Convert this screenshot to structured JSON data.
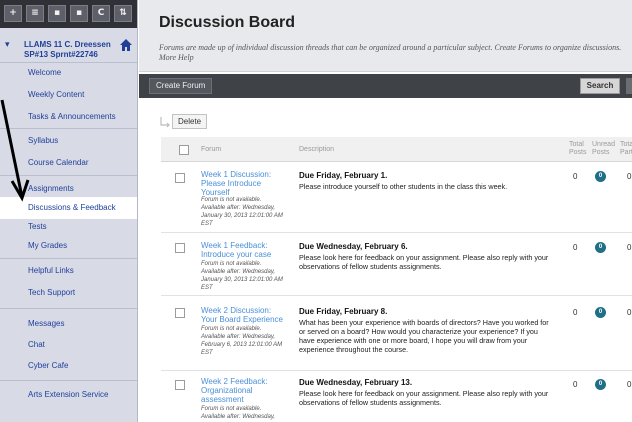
{
  "colors": {
    "sidebar_bg": "#d8dbe6",
    "toolbar_bg": "#2f3136",
    "link_blue": "#1f3f99",
    "forum_link": "#4a8fd8",
    "action_bar": "#3f4247",
    "badge": "#1f6f87"
  },
  "toolbar": {
    "buttons": [
      {
        "label": "+",
        "icon": "plus-icon"
      },
      {
        "label": "≡",
        "icon": "list-icon"
      },
      {
        "label": "▪",
        "icon": "folder-icon"
      },
      {
        "label": "▪",
        "icon": "window-icon"
      },
      {
        "label": "C",
        "icon": "refresh-icon"
      },
      {
        "label": "⇅",
        "icon": "sort-icon"
      }
    ]
  },
  "course": {
    "title": "LLAMS 11 C. Dreessen SP#13 Sprnt#22746",
    "home_icon": "home-icon"
  },
  "sidebar": {
    "items": [
      {
        "label": "Welcome"
      },
      {
        "label": "Weekly Content"
      },
      {
        "label": "Tasks & Announcements"
      },
      {
        "label": "Syllabus"
      },
      {
        "label": "Course Calendar"
      },
      {
        "label": "Assignments"
      },
      {
        "label": "Discussions & Feedback"
      },
      {
        "label": "Tests"
      },
      {
        "label": "My Grades"
      },
      {
        "label": "Helpful Links"
      },
      {
        "label": "Tech Support"
      },
      {
        "label": "Messages"
      },
      {
        "label": "Chat"
      },
      {
        "label": "Cyber Cafe"
      },
      {
        "label": "Arts Extension Service"
      }
    ]
  },
  "header": {
    "title": "Discussion Board",
    "description": "Forums are made up of individual discussion threads that can be organized around a particular subject. Create Forums to organize discussions. More Help"
  },
  "actions": {
    "create_forum": "Create Forum",
    "search": "Search",
    "delete": "Delete"
  },
  "columns": {
    "forum": "Forum",
    "description": "Description",
    "total_posts": "Total Posts",
    "unread_posts": "Unread Posts",
    "total_participants": "Total Participants"
  },
  "forums": [
    {
      "name": "Week 1 Discussion: Please Introduce Yourself",
      "meta": "Forum is not available. Available after: Wednesday, January 30, 2013 12:01:00 AM EST",
      "due": "Due Friday, February 1.",
      "desc": "Please introduce yourself to other students in the class this week.",
      "total": "0",
      "unread": "0",
      "participants": "0"
    },
    {
      "name": "Week 1 Feedback: Introduce your case",
      "meta": "Forum is not available. Available after: Wednesday, January 30, 2013 12:01:00 AM EST",
      "due": "Due Wednesday, February 6.",
      "desc": "Please look here for feedback on your assignment. Please also reply with your observations of fellow students assignments.",
      "total": "0",
      "unread": "0",
      "participants": "0"
    },
    {
      "name": "Week 2 Discussion: Your Board Experience",
      "meta": "Forum is not available. Available after: Wednesday, February 6, 2013 12:01:00 AM EST",
      "due": "Due Friday, February 8.",
      "desc": "What has been your experience with boards of directors? Have you worked for or served on a board? How would you characterize your experience? If you have experience with one or more board, I hope you will draw from your experience throughout the course.",
      "total": "0",
      "unread": "0",
      "participants": "0"
    },
    {
      "name": "Week 2 Feedback: Organizational assessment",
      "meta": "Forum is not available. Available after: Wednesday,",
      "due": "Due Wednesday, February 13.",
      "desc": "Please look here for feedback on your assignment. Please also reply with your observations of fellow students assignments.",
      "total": "0",
      "unread": "0",
      "participants": "0"
    }
  ]
}
